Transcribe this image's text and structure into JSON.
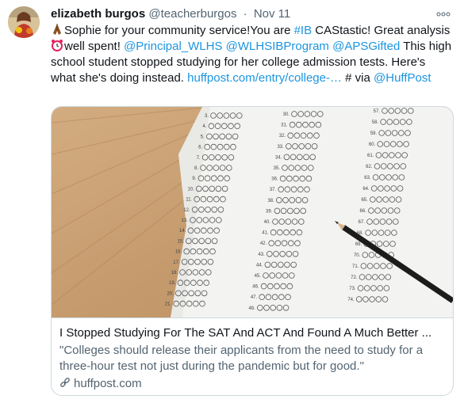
{
  "tweet": {
    "author_name": "elizabeth burgos",
    "author_handle": "@teacherburgos",
    "separator": "·",
    "time": "Nov 11",
    "more_label": "∘∘∘",
    "text_segments": [
      {
        "type": "text",
        "value": "Sophie for your community service!You are "
      },
      {
        "type": "link",
        "value": "#IB"
      },
      {
        "type": "text",
        "value": " CAStastic! Great analysis "
      },
      {
        "type": "text",
        "value": "well spent! "
      },
      {
        "type": "link",
        "value": "@Principal_WLHS"
      },
      {
        "type": "text",
        "value": " "
      },
      {
        "type": "link",
        "value": "@WLHSIBProgram"
      },
      {
        "type": "text",
        "value": " "
      },
      {
        "type": "link",
        "value": "@APSGifted"
      },
      {
        "type": "text",
        "value": " This high school student stopped studying for her college admission tests. Here's what she's doing instead. "
      },
      {
        "type": "link",
        "value": "huffpost.com/entry/college-…"
      },
      {
        "type": "text",
        "value": " # via "
      },
      {
        "type": "link",
        "value": "@HuffPost"
      }
    ]
  },
  "card": {
    "title": "I Stopped Studying For The SAT And ACT And Found A Much Better ...",
    "description": "\"Colleges should release their applicants from the need to study for a three-hour test not just during the pandemic but for good.\"",
    "domain": "huffpost.com"
  },
  "answer_sheet": {
    "left_numbers": [
      "3.",
      "4.",
      "5.",
      "6.",
      "7.",
      "8.",
      "9.",
      "10.",
      "11.",
      "12.",
      "13.",
      "14.",
      "15.",
      "16.",
      "17.",
      "18.",
      "19.",
      "20.",
      "21."
    ],
    "mid_numbers": [
      "30.",
      "31.",
      "32.",
      "33.",
      "34.",
      "35.",
      "36.",
      "37.",
      "38.",
      "39.",
      "40.",
      "41.",
      "42.",
      "43.",
      "44.",
      "45.",
      "46.",
      "47.",
      "48."
    ],
    "right_numbers": [
      "57.",
      "58.",
      "59.",
      "60.",
      "61.",
      "62.",
      "63.",
      "64.",
      "65.",
      "66.",
      "67.",
      "68.",
      "69.",
      "70.",
      "71.",
      "72.",
      "73.",
      "74."
    ]
  },
  "colors": {
    "link": "#1b95e0",
    "secondary_text": "#536471",
    "border": "#cfd9de",
    "wood": "#c49a6c",
    "paper": "#f4f4f2"
  },
  "icons": {
    "emoji_1": "praying-hands-icon",
    "emoji_2": "alarm-clock-icon",
    "card_link": "link-icon"
  }
}
